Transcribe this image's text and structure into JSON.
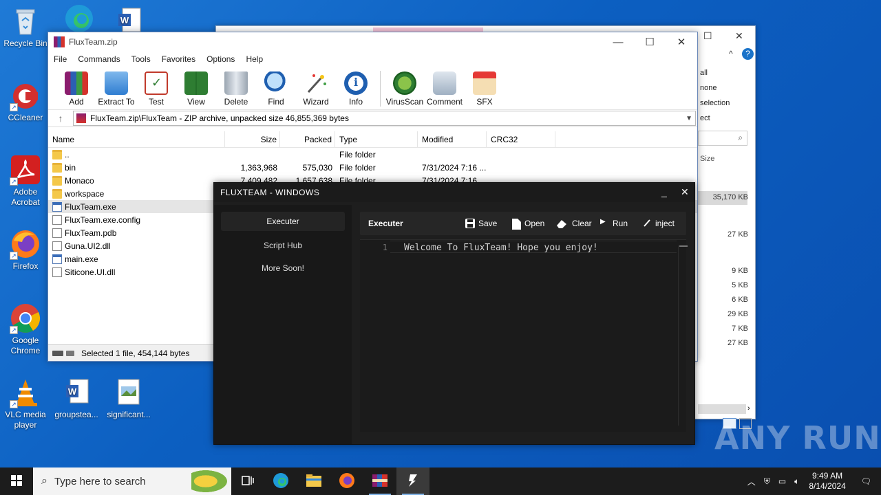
{
  "desktop": {
    "icons": [
      {
        "label": "Recycle Bin"
      },
      {
        "label": "CCleaner"
      },
      {
        "label": "Adobe Acrobat"
      },
      {
        "label": "Firefox"
      },
      {
        "label": "Google Chrome"
      },
      {
        "label": "VLC media player"
      },
      {
        "label": "groupstea..."
      },
      {
        "label": "significant..."
      }
    ],
    "watermark": "ANY RUN"
  },
  "explorer": {
    "side_items": [
      "all",
      "none",
      "selection",
      "ect"
    ],
    "size_header": "Size",
    "sizes": [
      "35,170 KB",
      "27 KB",
      "9 KB",
      "5 KB",
      "6 KB",
      "29 KB",
      "7 KB",
      "27 KB"
    ]
  },
  "winrar": {
    "title": "FluxTeam.zip",
    "menu": [
      "File",
      "Commands",
      "Tools",
      "Favorites",
      "Options",
      "Help"
    ],
    "toolbar": [
      "Add",
      "Extract To",
      "Test",
      "View",
      "Delete",
      "Find",
      "Wizard",
      "Info",
      "VirusScan",
      "Comment",
      "SFX"
    ],
    "path": "FluxTeam.zip\\FluxTeam - ZIP archive, unpacked size 46,855,369 bytes",
    "columns": {
      "name": "Name",
      "size": "Size",
      "packed": "Packed",
      "type": "Type",
      "modified": "Modified",
      "crc": "CRC32"
    },
    "files": [
      {
        "name": "..",
        "size": "",
        "packed": "",
        "type": "File folder",
        "modified": "",
        "icon": "folder"
      },
      {
        "name": "bin",
        "size": "1,363,968",
        "packed": "575,030",
        "type": "File folder",
        "modified": "7/31/2024 7:16 ...",
        "icon": "folder"
      },
      {
        "name": "Monaco",
        "size": "7,409,482",
        "packed": "1,657,638",
        "type": "File folder",
        "modified": "7/31/2024 7:16 ...",
        "icon": "folder"
      },
      {
        "name": "workspace",
        "size": "",
        "packed": "",
        "type": "",
        "modified": "",
        "icon": "folder"
      },
      {
        "name": "FluxTeam.exe",
        "size": "",
        "packed": "",
        "type": "",
        "modified": "",
        "icon": "exe"
      },
      {
        "name": "FluxTeam.exe.config",
        "size": "",
        "packed": "",
        "type": "",
        "modified": "",
        "icon": "doc"
      },
      {
        "name": "FluxTeam.pdb",
        "size": "",
        "packed": "",
        "type": "",
        "modified": "",
        "icon": "doc"
      },
      {
        "name": "Guna.UI2.dll",
        "size": "",
        "packed": "",
        "type": "",
        "modified": "",
        "icon": "dll"
      },
      {
        "name": "main.exe",
        "size": "",
        "packed": "",
        "type": "",
        "modified": "",
        "icon": "exe"
      },
      {
        "name": "Siticone.UI.dll",
        "size": "",
        "packed": "",
        "type": "",
        "modified": "",
        "icon": "dll"
      }
    ],
    "status": "Selected 1 file, 454,144 bytes"
  },
  "flux": {
    "title": "FLUXTEAM - WINDOWS",
    "min": "_",
    "close": "✕",
    "nav": [
      "Executer",
      "Script Hub",
      "More Soon!"
    ],
    "tab": "Executer",
    "actions": {
      "save": "Save",
      "open": "Open",
      "clear": "Clear",
      "run": "Run",
      "inject": "inject"
    },
    "editor": {
      "line": "1",
      "code": "Welcome To FluxTeam! Hope you enjoy!"
    }
  },
  "taskbar": {
    "search_placeholder": "Type here to search",
    "time": "9:49 AM",
    "date": "8/14/2024"
  }
}
